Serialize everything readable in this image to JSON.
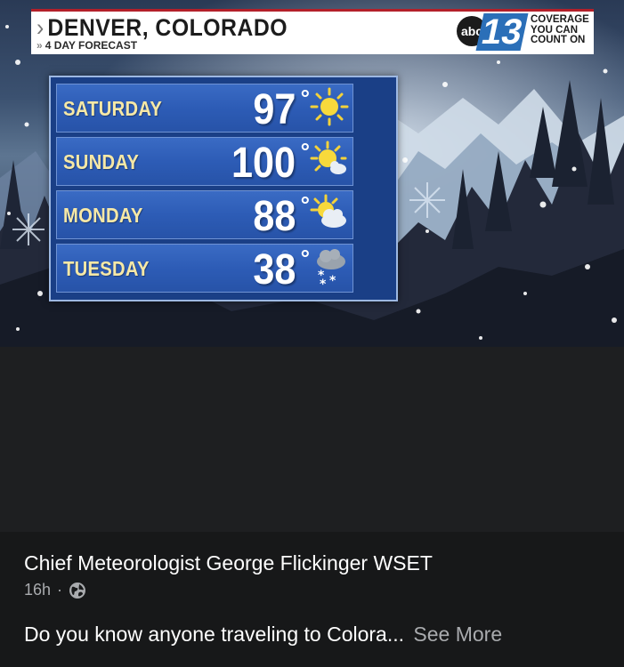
{
  "forecast": {
    "city": "DENVER, COLORADO",
    "subtitle": "4 DAY FORECAST",
    "logo_network": "abc",
    "logo_channel": "13",
    "tagline": [
      "COVERAGE",
      "YOU CAN",
      "COUNT ON"
    ],
    "days": [
      {
        "day": "SATURDAY",
        "temp": "97",
        "degree": "°",
        "icon": "sun-icon"
      },
      {
        "day": "SUNDAY",
        "temp": "100",
        "degree": "°",
        "icon": "sun-cloud-icon"
      },
      {
        "day": "MONDAY",
        "temp": "88",
        "degree": "°",
        "icon": "partly-cloudy-icon"
      },
      {
        "day": "TUESDAY",
        "temp": "38",
        "degree": "°",
        "icon": "snow-icon"
      }
    ]
  },
  "post": {
    "author": "Chief Meteorologist George Flickinger WSET",
    "time": "16h",
    "separator": "·",
    "privacy_icon": "globe-icon",
    "caption": "Do you know anyone traveling to Colora...",
    "see_more": "See More"
  },
  "colors": {
    "panel_blue": "#1a3f86",
    "row_blue": "#2d5cb6",
    "day_text": "#f6e8a6",
    "post_bg": "#171819",
    "muted_text": "#a9abae"
  }
}
